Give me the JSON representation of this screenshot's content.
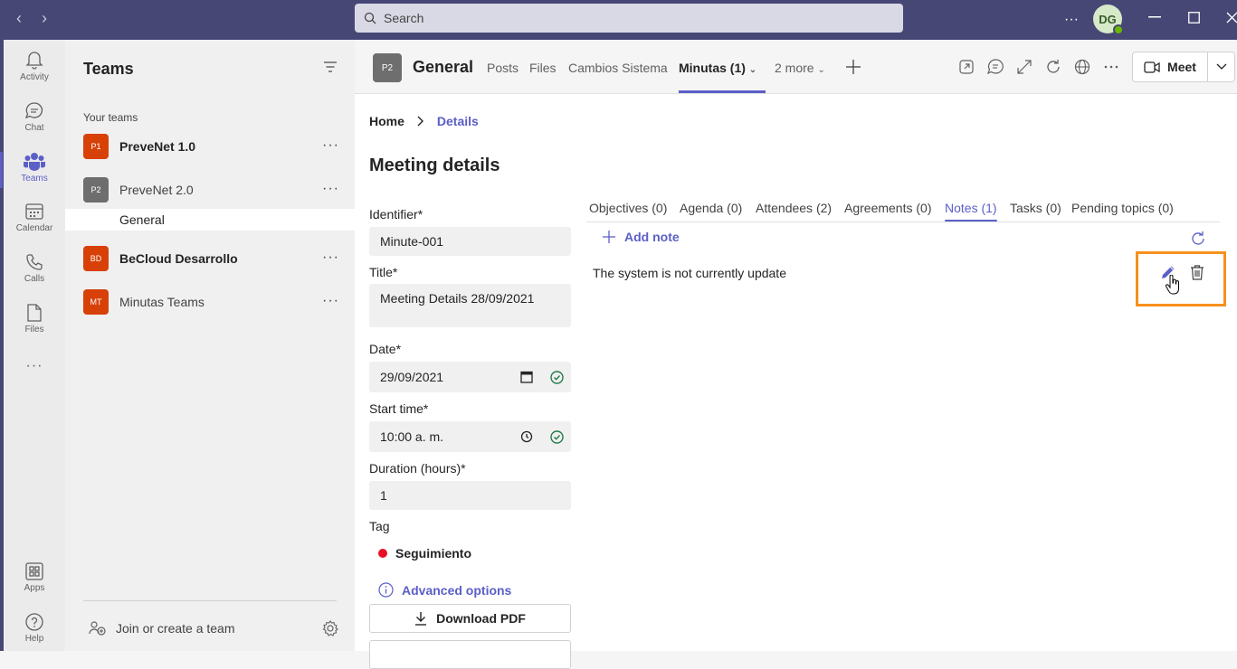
{
  "titlebar": {
    "search_placeholder": "Search",
    "more": "···",
    "avatar_initials": "DG"
  },
  "rail": {
    "items": [
      {
        "label": "Activity",
        "icon": "bell-icon"
      },
      {
        "label": "Chat",
        "icon": "chat-icon"
      },
      {
        "label": "Teams",
        "icon": "teams-icon",
        "active": true
      },
      {
        "label": "Calendar",
        "icon": "calendar-icon"
      },
      {
        "label": "Calls",
        "icon": "phone-icon"
      },
      {
        "label": "Files",
        "icon": "file-icon"
      }
    ],
    "more": "···",
    "apps_label": "Apps",
    "help_label": "Help"
  },
  "teams_panel": {
    "title": "Teams",
    "section_label": "Your teams",
    "teams": [
      {
        "initials": "P1",
        "name": "PreveNet 1.0",
        "color": "#d74108",
        "bold": true
      },
      {
        "initials": "P2",
        "name": "PreveNet 2.0",
        "color": "#6e6e6e",
        "bold": false
      },
      {
        "initials": "BD",
        "name": "BeCloud Desarrollo",
        "color": "#d74108",
        "bold": true
      },
      {
        "initials": "MT",
        "name": "Minutas Teams",
        "color": "#d74108",
        "bold": false
      }
    ],
    "channel": "General",
    "more": "···",
    "join_label": "Join or create a team"
  },
  "header": {
    "channel_initials": "P2",
    "channel_name": "General",
    "tabs": [
      "Posts",
      "Files",
      "Cambios Sistema",
      "Minutas (1)",
      "2 more"
    ],
    "meet_label": "Meet"
  },
  "content": {
    "breadcrumb": {
      "home": "Home",
      "current": "Details"
    },
    "title": "Meeting details",
    "form": {
      "identifier_label": "Identifier*",
      "identifier_value": "Minute-001",
      "title_label": "Title*",
      "title_value": "Meeting  Details 28/09/2021",
      "date_label": "Date*",
      "date_value": "29/09/2021",
      "start_label": "Start time*",
      "start_value": "10:00  a. m.",
      "duration_label": "Duration (hours)*",
      "duration_value": "1",
      "tag_label": "Tag",
      "tag_value": "Seguimiento",
      "tag_color": "#e81123",
      "advanced_label": "Advanced options",
      "download_label": "Download PDF"
    },
    "detail_tabs": [
      "Objectives (0)",
      "Agenda (0)",
      "Attendees (2)",
      "Agreements (0)",
      "Notes (1)",
      "Tasks (0)",
      "Pending topics (0)"
    ],
    "active_detail_tab": "Notes (1)",
    "add_note_label": "Add note",
    "note_text": "The system is not currently update"
  },
  "colors": {
    "accent": "#5b5fc7",
    "titlebar": "#464775",
    "highlight": "#f7901e"
  }
}
